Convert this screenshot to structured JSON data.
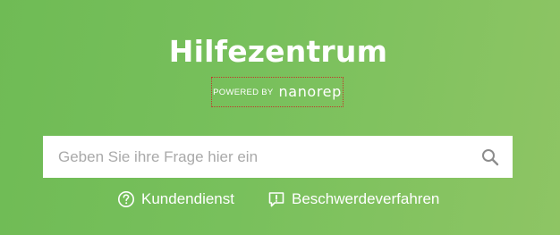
{
  "header": {
    "title": "Hilfezentrum",
    "powered_prefix": "POWERED BY",
    "powered_brand": "nanorep"
  },
  "search": {
    "placeholder": "Geben Sie ihre Frage hier ein",
    "value": "",
    "icon": "search-icon"
  },
  "links": [
    {
      "label": "Kundendienst",
      "icon": "question-circle-icon"
    },
    {
      "label": "Beschwerdeverfahren",
      "icon": "speech-bubble-exclamation-icon"
    }
  ],
  "colors": {
    "background_left": "#6fbb55",
    "background_right": "#8ec564",
    "text": "#ffffff",
    "placeholder": "#a9a9a9",
    "highlight_border": "#c0392b"
  }
}
